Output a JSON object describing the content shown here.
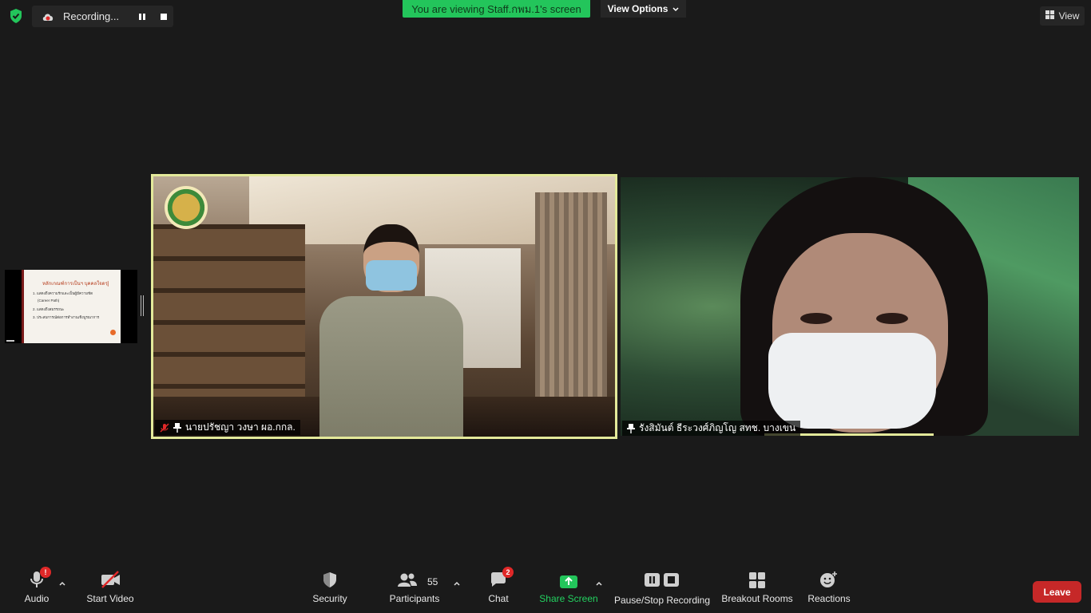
{
  "top_bar": {
    "security_icon": "shield-check-icon",
    "recording_label": "Recording...",
    "share_banner": "You are viewing Staff.กพม.1's screen",
    "view_options_label": "View Options",
    "view_label": "View"
  },
  "shared_slide": {
    "title": "หลักเกณฑ์การเป็นฯ บุคคลใจดรฺ]",
    "lines": [
      "1. แสดงถึงความรักและเป็นผู้มีความชัด",
      "(Career Path)",
      "2. แสดงถึงสมรรถนะ",
      "3. ประสบการณ์ต่อการทำงานเชิงบูรณาการ"
    ]
  },
  "participants": [
    {
      "name": "นายปรัชญา วงษา ผอ.กกล.",
      "muted": true,
      "pinned": true
    },
    {
      "name": "รังสิมันต์ ธีระวงศ์ภิญโญ สทช. บางเขน",
      "muted": false,
      "pinned": true
    }
  ],
  "toolbar": {
    "audio_label": "Audio",
    "audio_alert": "!",
    "video_label": "Start Video",
    "security_label": "Security",
    "participants_label": "Participants",
    "participants_count": "55",
    "chat_label": "Chat",
    "chat_badge": "2",
    "share_label": "Share Screen",
    "recording_label": "Pause/Stop Recording",
    "breakout_label": "Breakout Rooms",
    "reactions_label": "Reactions",
    "leave_label": "Leave"
  },
  "colors": {
    "background": "#1a1a1a",
    "share_green": "#23c55b",
    "active_speaker": "#e3e99a",
    "leave_red": "#c62828",
    "badge_red": "#e02828"
  }
}
